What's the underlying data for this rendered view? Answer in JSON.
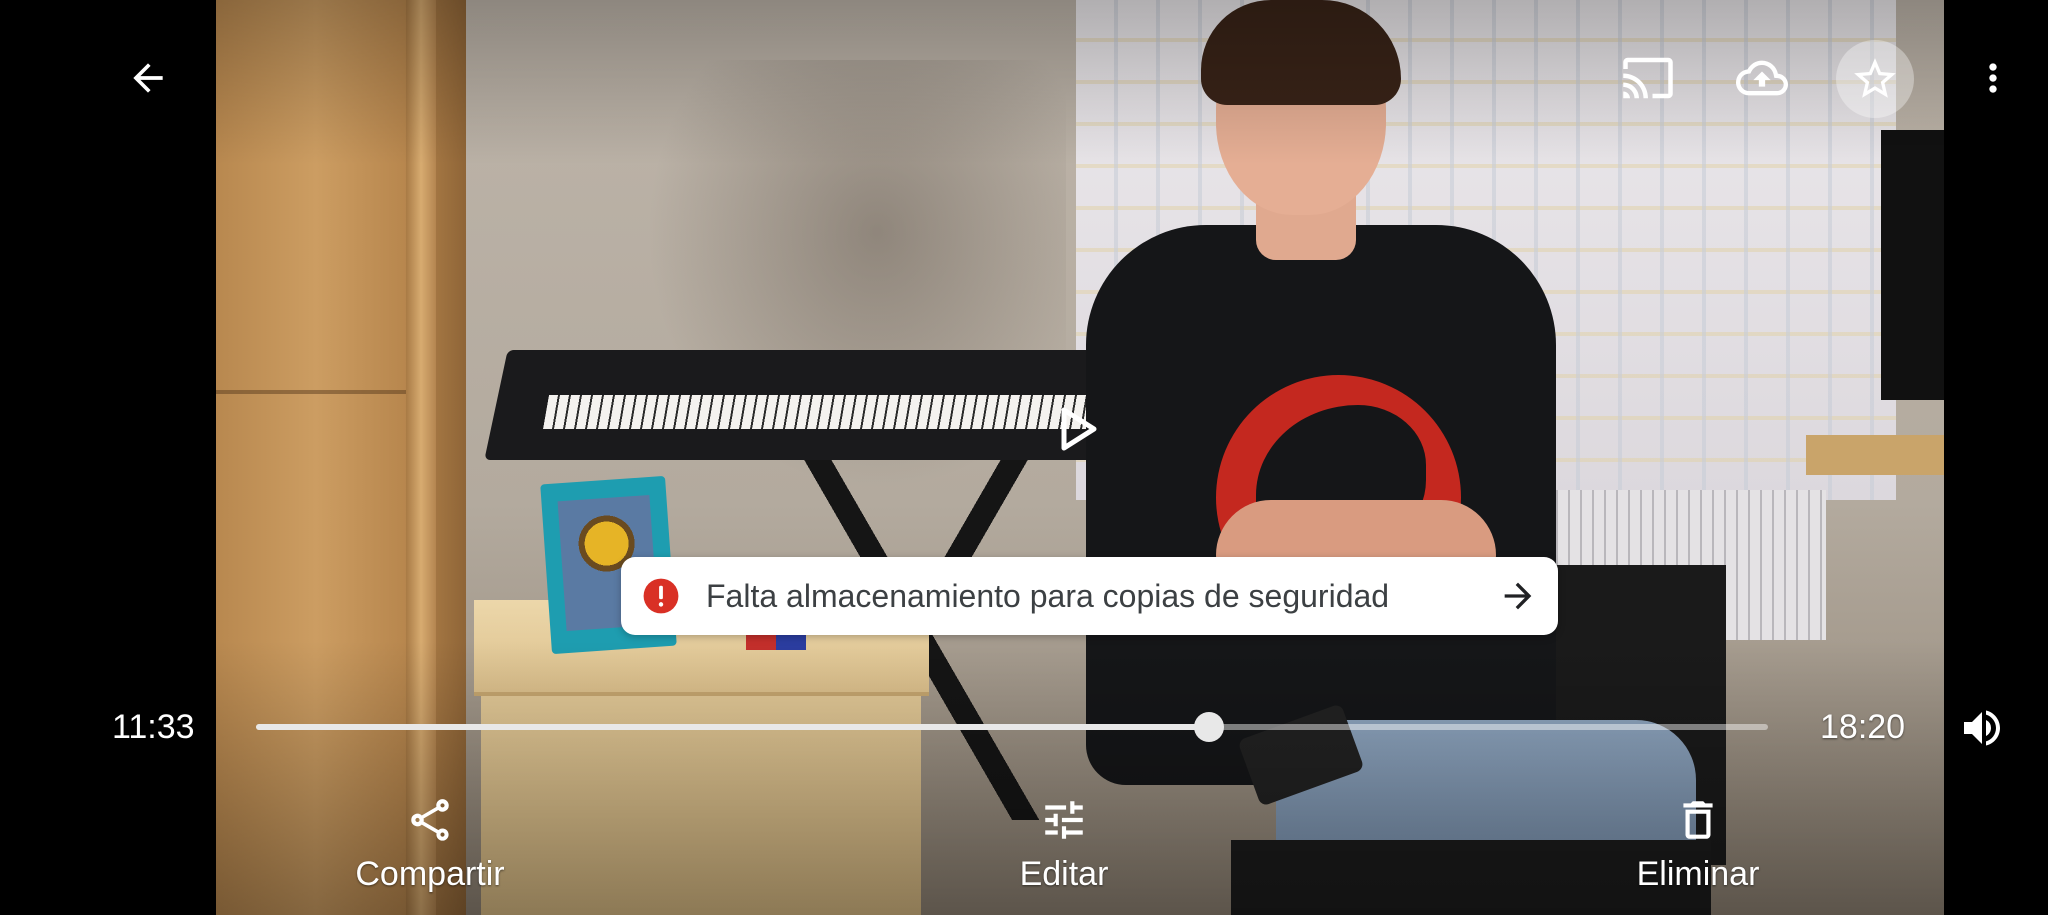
{
  "app": "Google Photos video player",
  "top_bar": {
    "back_icon": "arrow-back-icon",
    "cast_icon": "cast-icon",
    "backup_icon": "cloud-upload-icon",
    "favorite_icon": "star-outline-icon",
    "more_icon": "more-vert-icon"
  },
  "player": {
    "play_icon": "play-icon",
    "elapsed": "11:33",
    "duration": "18:20",
    "progress_fraction": 0.63,
    "volume_icon": "volume-up-icon"
  },
  "snackbar": {
    "text": "Falta almacenamiento para copias de seguridad",
    "icon": "error-icon",
    "action_icon": "arrow-forward-icon",
    "icon_color": "#d93025"
  },
  "actions": [
    {
      "label": "Compartir",
      "icon": "share-icon"
    },
    {
      "label": "Editar",
      "icon": "tune-icon"
    },
    {
      "label": "Eliminar",
      "icon": "delete-icon"
    }
  ]
}
